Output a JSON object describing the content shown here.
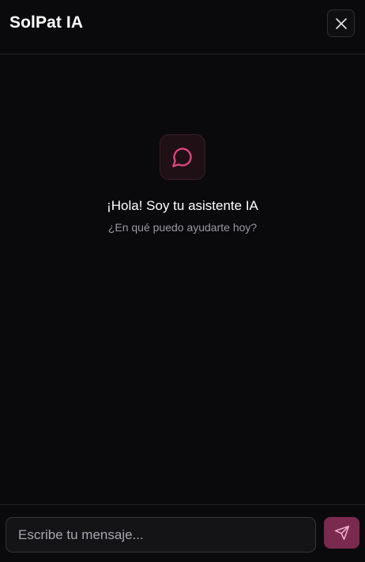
{
  "header": {
    "title": "SolPat IA",
    "close_icon": "close-icon"
  },
  "empty_state": {
    "icon": "chat-bubble-icon",
    "greeting": "¡Hola! Soy tu asistente IA",
    "subtitle": "¿En qué puedo ayudarte hoy?"
  },
  "composer": {
    "input_value": "",
    "input_placeholder": "Escribe tu mensaje...",
    "send_icon": "send-icon"
  },
  "colors": {
    "accent": "#e0457f",
    "send_button": "#7a2a4e",
    "background": "#0a0a0c"
  }
}
